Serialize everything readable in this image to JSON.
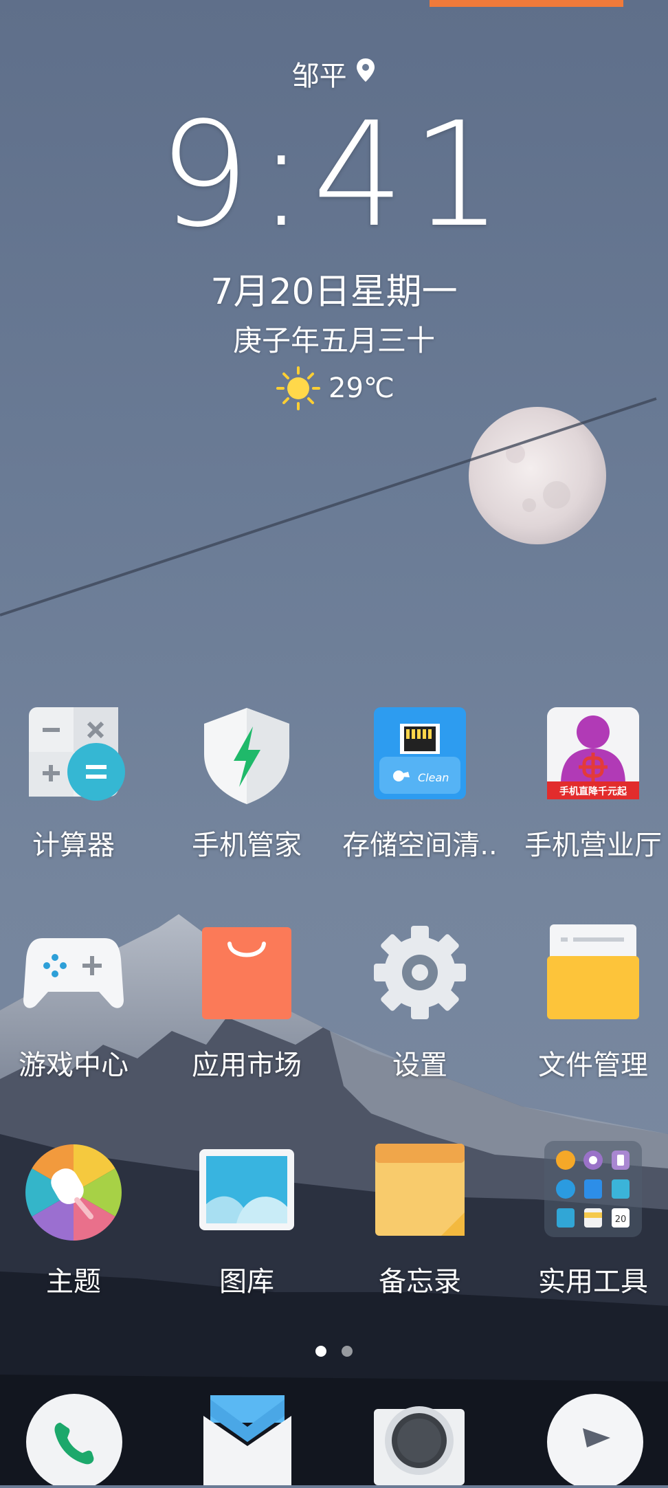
{
  "lockscreen": {
    "city": "邹平",
    "time": "9:41",
    "date": "7月20日星期一",
    "lunar": "庚子年五月三十",
    "temperature": "29℃",
    "weather_icon": "sun-icon"
  },
  "apps": {
    "row1": [
      {
        "label": "计算器",
        "icon": "calculator-icon"
      },
      {
        "label": "手机管家",
        "icon": "shield-lightning-icon"
      },
      {
        "label": "存储空间清..",
        "icon": "sd-card-clean-icon"
      },
      {
        "label": "手机营业厅",
        "icon": "unicom-icon"
      }
    ],
    "row2": [
      {
        "label": "游戏中心",
        "icon": "gamepad-icon"
      },
      {
        "label": "应用市场",
        "icon": "shopping-bag-icon"
      },
      {
        "label": "设置",
        "icon": "gear-icon"
      },
      {
        "label": "文件管理",
        "icon": "folder-icon"
      }
    ],
    "row3": [
      {
        "label": "主题",
        "icon": "theme-palette-icon"
      },
      {
        "label": "图库",
        "icon": "gallery-icon"
      },
      {
        "label": "备忘录",
        "icon": "notes-icon"
      },
      {
        "label": "实用工具",
        "icon": "tools-folder-icon",
        "badge": "20"
      }
    ]
  },
  "unicom_banner": "手机直降千元起",
  "clean_text": "Clean",
  "page_indicator": {
    "pages": 2,
    "current": 1
  },
  "dock": [
    {
      "icon": "phone-icon"
    },
    {
      "icon": "mail-icon"
    },
    {
      "icon": "camera-icon"
    },
    {
      "icon": "browser-icon"
    }
  ],
  "colors": {
    "accent_orange": "#f07a3a",
    "sky": "#6a7b95"
  }
}
